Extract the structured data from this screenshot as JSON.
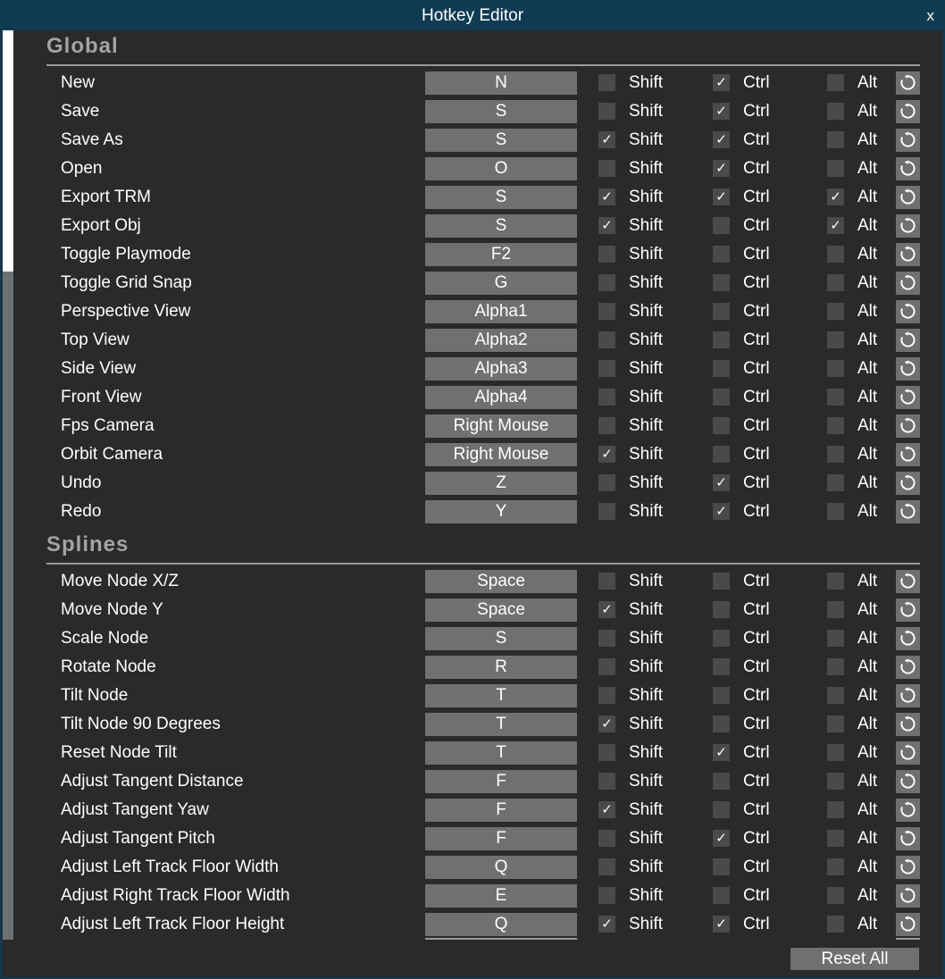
{
  "window": {
    "title": "Hotkey Editor",
    "close_label": "x"
  },
  "modifiers": {
    "shift": "Shift",
    "ctrl": "Ctrl",
    "alt": "Alt"
  },
  "icons": {
    "check": "✓",
    "reset": "reset-icon"
  },
  "colors": {
    "titlebar": "#0f3c53",
    "panel": "#2a2a2a",
    "button": "#707070",
    "checkbox": "#4a4a4a",
    "scroll_thumb": "#ffffff"
  },
  "sections": [
    {
      "title": "Global",
      "rows": [
        {
          "label": "New",
          "key": "N",
          "shift": false,
          "ctrl": true,
          "alt": false
        },
        {
          "label": "Save",
          "key": "S",
          "shift": false,
          "ctrl": true,
          "alt": false
        },
        {
          "label": "Save As",
          "key": "S",
          "shift": true,
          "ctrl": true,
          "alt": false
        },
        {
          "label": "Open",
          "key": "O",
          "shift": false,
          "ctrl": true,
          "alt": false
        },
        {
          "label": "Export TRM",
          "key": "S",
          "shift": true,
          "ctrl": true,
          "alt": true
        },
        {
          "label": "Export Obj",
          "key": "S",
          "shift": true,
          "ctrl": false,
          "alt": true
        },
        {
          "label": "Toggle Playmode",
          "key": "F2",
          "shift": false,
          "ctrl": false,
          "alt": false
        },
        {
          "label": "Toggle Grid Snap",
          "key": "G",
          "shift": false,
          "ctrl": false,
          "alt": false
        },
        {
          "label": "Perspective View",
          "key": "Alpha1",
          "shift": false,
          "ctrl": false,
          "alt": false
        },
        {
          "label": "Top View",
          "key": "Alpha2",
          "shift": false,
          "ctrl": false,
          "alt": false
        },
        {
          "label": "Side View",
          "key": "Alpha3",
          "shift": false,
          "ctrl": false,
          "alt": false
        },
        {
          "label": "Front View",
          "key": "Alpha4",
          "shift": false,
          "ctrl": false,
          "alt": false
        },
        {
          "label": "Fps Camera",
          "key": "Right Mouse",
          "shift": false,
          "ctrl": false,
          "alt": false
        },
        {
          "label": "Orbit Camera",
          "key": "Right Mouse",
          "shift": true,
          "ctrl": false,
          "alt": false
        },
        {
          "label": "Undo",
          "key": "Z",
          "shift": false,
          "ctrl": true,
          "alt": false
        },
        {
          "label": "Redo",
          "key": "Y",
          "shift": false,
          "ctrl": true,
          "alt": false
        }
      ]
    },
    {
      "title": "Splines",
      "rows": [
        {
          "label": "Move Node X/Z",
          "key": "Space",
          "shift": false,
          "ctrl": false,
          "alt": false
        },
        {
          "label": "Move Node Y",
          "key": "Space",
          "shift": true,
          "ctrl": false,
          "alt": false
        },
        {
          "label": "Scale Node",
          "key": "S",
          "shift": false,
          "ctrl": false,
          "alt": false
        },
        {
          "label": "Rotate Node",
          "key": "R",
          "shift": false,
          "ctrl": false,
          "alt": false
        },
        {
          "label": "Tilt Node",
          "key": "T",
          "shift": false,
          "ctrl": false,
          "alt": false
        },
        {
          "label": "Tilt Node 90 Degrees",
          "key": "T",
          "shift": true,
          "ctrl": false,
          "alt": false
        },
        {
          "label": "Reset Node Tilt",
          "key": "T",
          "shift": false,
          "ctrl": true,
          "alt": false
        },
        {
          "label": "Adjust Tangent Distance",
          "key": "F",
          "shift": false,
          "ctrl": false,
          "alt": false
        },
        {
          "label": "Adjust Tangent Yaw",
          "key": "F",
          "shift": true,
          "ctrl": false,
          "alt": false
        },
        {
          "label": "Adjust Tangent Pitch",
          "key": "F",
          "shift": false,
          "ctrl": true,
          "alt": false
        },
        {
          "label": "Adjust Left Track Floor Width",
          "key": "Q",
          "shift": false,
          "ctrl": false,
          "alt": false
        },
        {
          "label": "Adjust Right Track Floor Width",
          "key": "E",
          "shift": false,
          "ctrl": false,
          "alt": false
        },
        {
          "label": "Adjust Left Track Floor Height",
          "key": "Q",
          "shift": true,
          "ctrl": true,
          "alt": false
        }
      ]
    }
  ],
  "footer": {
    "reset_all_label": "Reset All"
  }
}
